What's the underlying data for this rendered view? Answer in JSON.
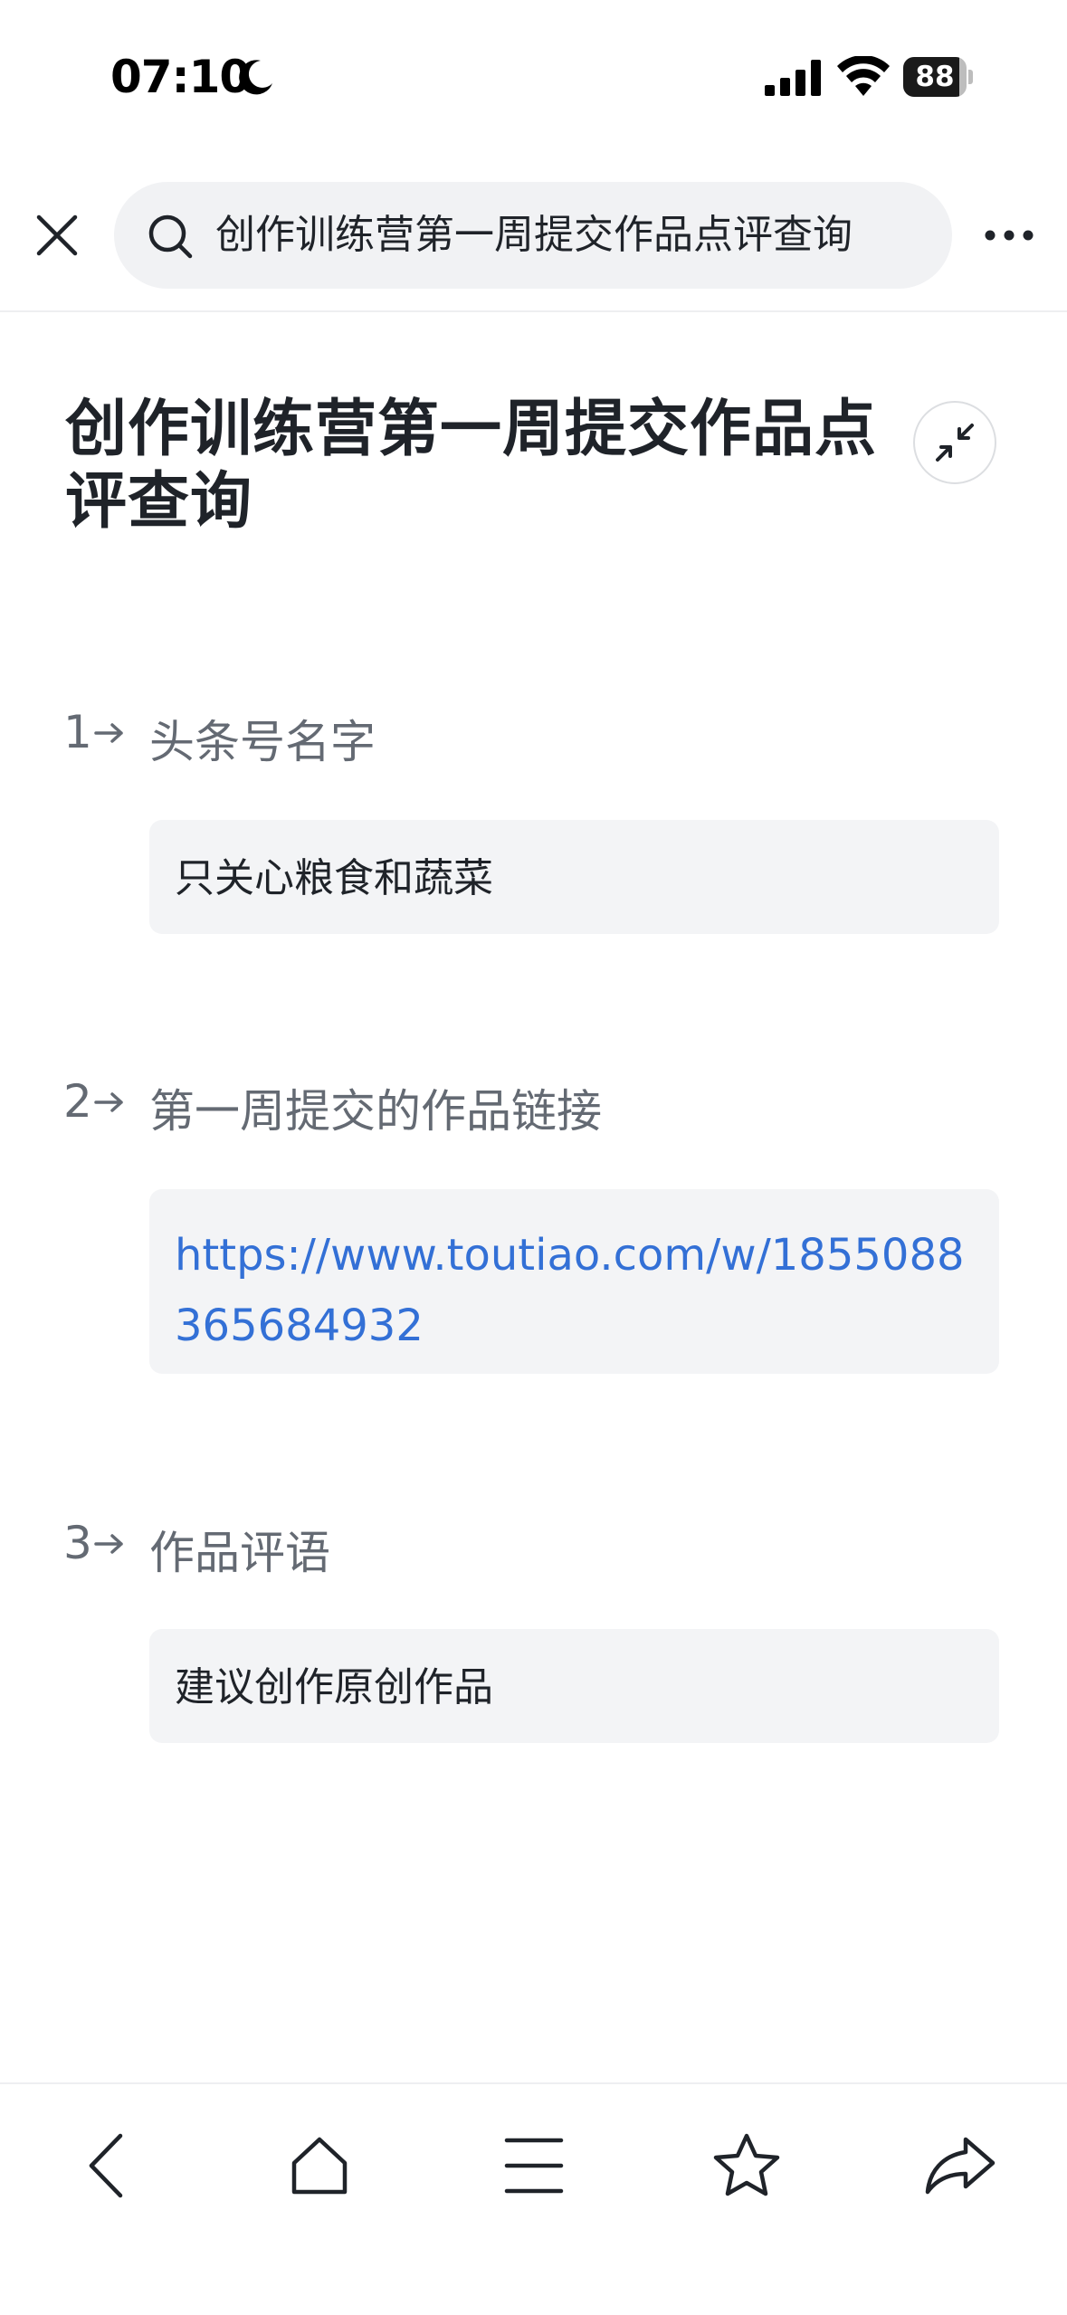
{
  "status_bar": {
    "time": "07:10",
    "battery_level": "88",
    "icons": [
      "moon-icon",
      "signal-icon",
      "wifi-icon",
      "battery-icon"
    ]
  },
  "topbar": {
    "search_text": "创作训练营第一周提交作品点评查询",
    "icons": [
      "close-icon",
      "search-icon",
      "more-icon"
    ]
  },
  "page": {
    "title": "创作训练营第一周提交作品点评查询"
  },
  "questions": [
    {
      "num": "1",
      "label": "头条号名字",
      "answer": "只关心粮食和蔬菜"
    },
    {
      "num": "2",
      "label": "第一周提交的作品链接",
      "answer": "https://www.toutiao.com/w/1855088365684932"
    },
    {
      "num": "3",
      "label": "作品评语",
      "answer": "建议创作原创作品"
    }
  ],
  "bottom_bar": {
    "icons": [
      "back-icon",
      "home-icon",
      "menu-icon",
      "star-icon",
      "share-icon"
    ]
  },
  "colors": {
    "link": "#3370d6",
    "answer_bg": "#f3f4f6",
    "label": "#646a73",
    "text": "#1f2329"
  }
}
